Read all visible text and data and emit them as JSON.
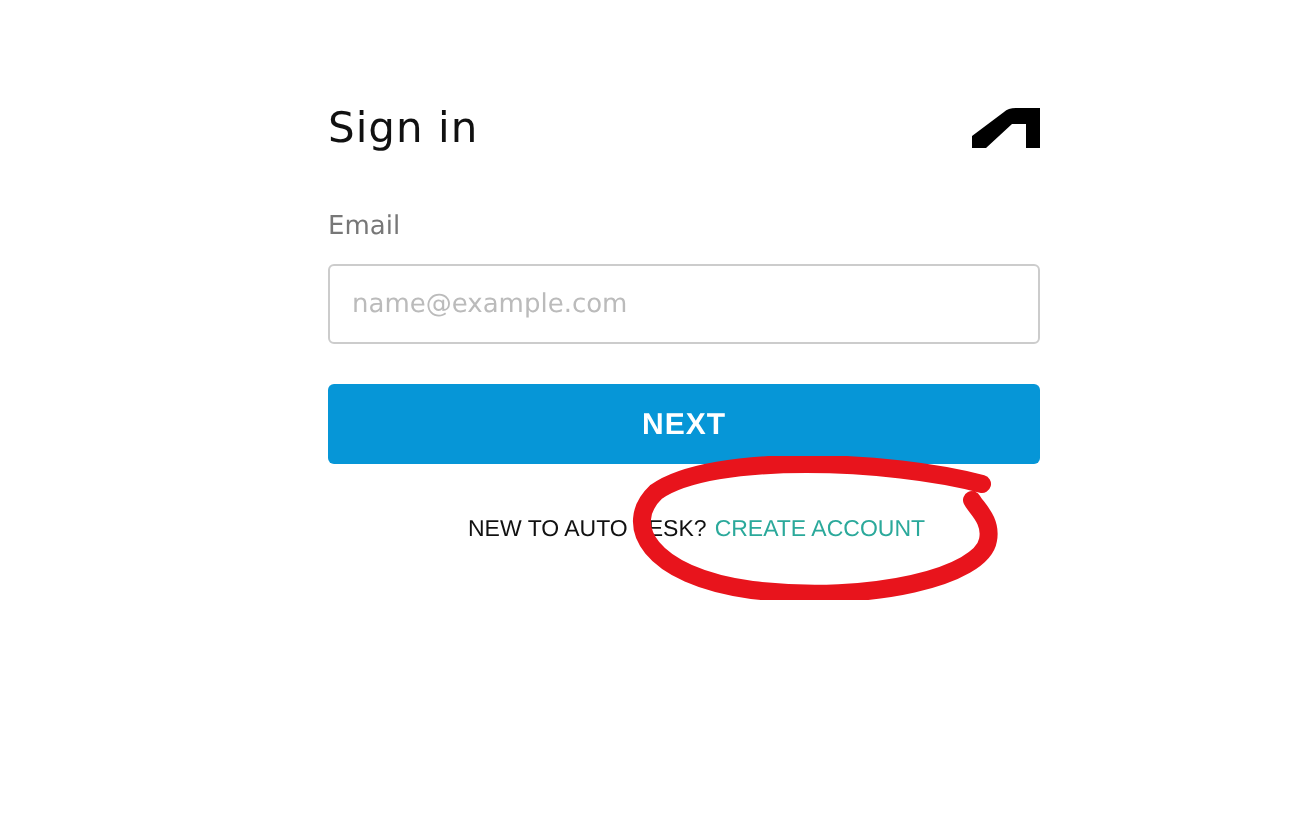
{
  "header": {
    "title": "Sign in"
  },
  "email": {
    "label": "Email",
    "placeholder": "name@example.com"
  },
  "next_button": {
    "label": "NEXT"
  },
  "footer": {
    "prompt_start": "NEW TO AUTO",
    "prompt_end": "ESK?",
    "link": "CREATE ACCOUNT"
  }
}
